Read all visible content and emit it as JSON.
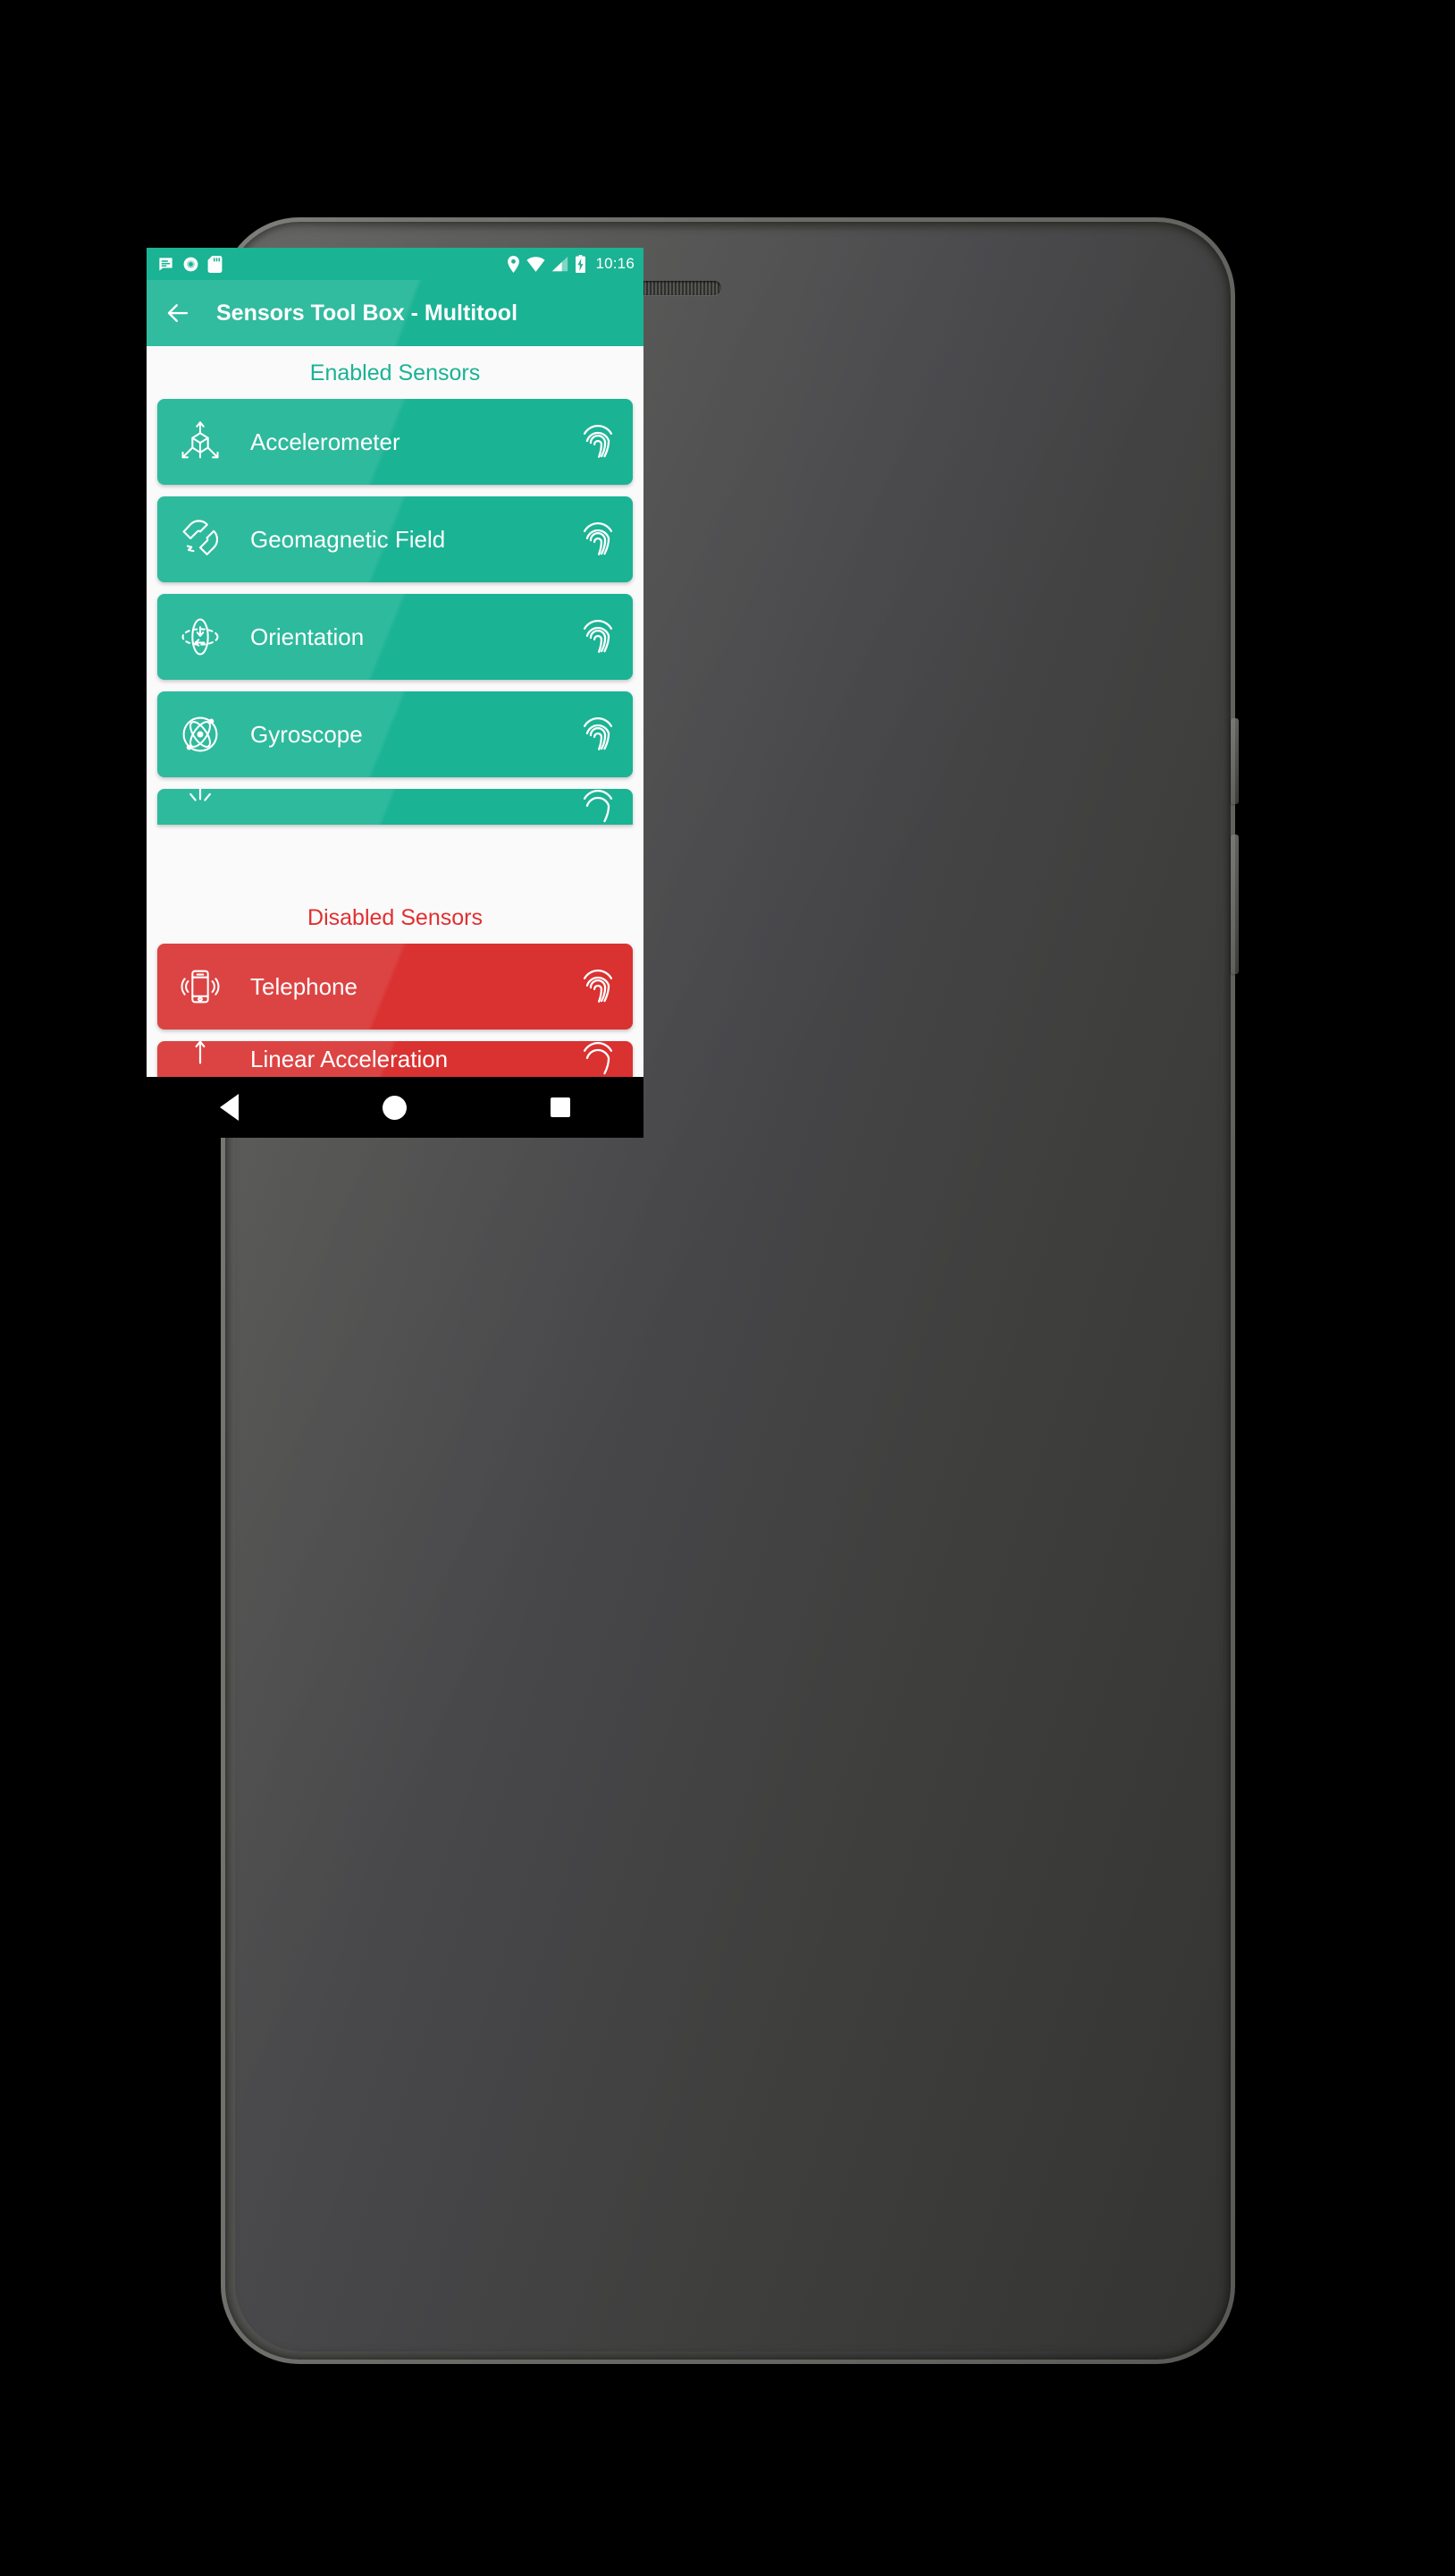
{
  "device": {
    "kind": "android-phone",
    "front_camera_icon": "front-camera",
    "earpiece_icon": "earpiece-speaker"
  },
  "statusbar": {
    "time": "10:16",
    "left_icons": [
      {
        "name": "notification-message-icon",
        "label": "message"
      },
      {
        "name": "record-circle-icon",
        "label": "recording"
      },
      {
        "name": "sd-card-icon",
        "label": "sd card"
      }
    ],
    "right_icons": [
      {
        "name": "location-pin-icon",
        "label": "location"
      },
      {
        "name": "wifi-icon",
        "label": "wifi"
      },
      {
        "name": "cellular-signal-icon",
        "label": "signal"
      },
      {
        "name": "battery-charging-icon",
        "label": "battery charging"
      }
    ],
    "background_color": "#1ab394"
  },
  "appbar": {
    "back_icon": "back-arrow-icon",
    "title": "Sensors Tool Box - Multitool",
    "background_color": "#1ab394"
  },
  "sections": [
    {
      "id": "enabled",
      "heading": "Enabled Sensors",
      "heading_color": "#1ab394",
      "card_color": "#1ab394",
      "items": [
        {
          "label": "Accelerometer",
          "icon": "axis-3d-icon",
          "trailing_icon": "fingerprint-icon",
          "state": "enabled"
        },
        {
          "label": "Geomagnetic Field",
          "icon": "magnet-icon",
          "trailing_icon": "fingerprint-icon",
          "state": "enabled"
        },
        {
          "label": "Orientation",
          "icon": "rotation-sphere-icon",
          "trailing_icon": "fingerprint-icon",
          "state": "enabled"
        },
        {
          "label": "Gyroscope",
          "icon": "gyroscope-atom-icon",
          "trailing_icon": "fingerprint-icon",
          "state": "enabled"
        },
        {
          "label": "",
          "icon": "light-sensor-icon",
          "trailing_icon": "fingerprint-icon",
          "state": "enabled",
          "clipped": true
        }
      ]
    },
    {
      "id": "disabled",
      "heading": "Disabled Sensors",
      "heading_color": "#e03030",
      "card_color": "#d93231",
      "items": [
        {
          "label": "Telephone",
          "icon": "vibrating-phone-icon",
          "trailing_icon": "fingerprint-icon",
          "state": "disabled"
        },
        {
          "label": "Linear Acceleration",
          "icon": "arrow-up-axis-icon",
          "trailing_icon": "fingerprint-icon",
          "state": "disabled",
          "clipped": true
        }
      ]
    }
  ],
  "navbar": {
    "buttons": [
      {
        "name": "nav-back-button",
        "label": "Back"
      },
      {
        "name": "nav-home-button",
        "label": "Home"
      },
      {
        "name": "nav-recents-button",
        "label": "Recents"
      }
    ],
    "background_color": "#000000"
  }
}
